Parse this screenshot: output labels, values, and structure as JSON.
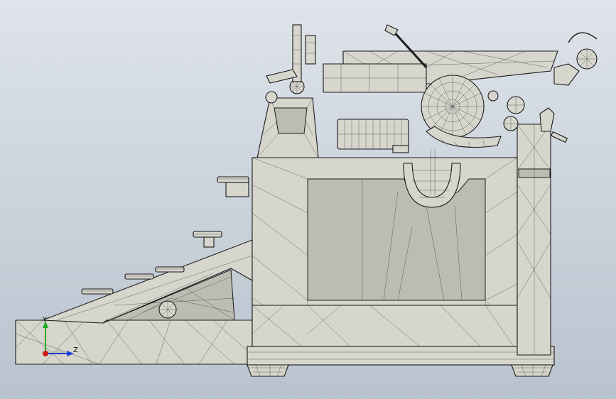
{
  "viewport": {
    "background_top": "#dfe4ea",
    "background_bottom": "#b9c3ce",
    "model_fill": "#d7d6cd",
    "edge_color": "#1a1a1a"
  },
  "triad": {
    "y_label": "Y",
    "z_label": "Z",
    "y_color": "#22aa22",
    "z_color": "#1a3fd6",
    "x_color": "#d01a1a"
  }
}
